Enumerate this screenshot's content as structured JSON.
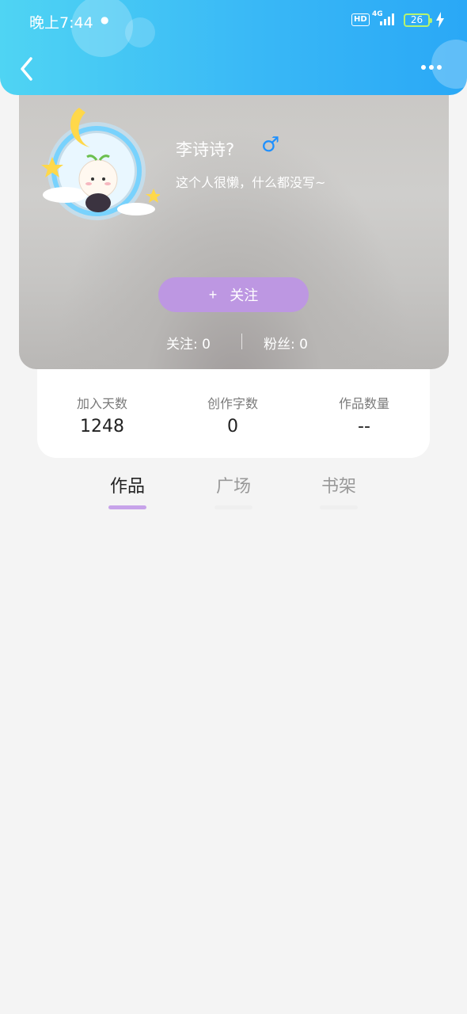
{
  "status_bar": {
    "time": "晚上7:44",
    "hd": "HD",
    "network": "4G",
    "battery": "26"
  },
  "profile": {
    "username": "李诗诗?",
    "gender_symbol": "♂",
    "bio": "这个人很懒，什么都没写~",
    "follow_button_icon": "+",
    "follow_button_label": "关注",
    "following_label": "关注: 0",
    "followers_label": "粉丝: 0"
  },
  "stats": [
    {
      "label": "加入天数",
      "value": "1248"
    },
    {
      "label": "创作字数",
      "value": "0"
    },
    {
      "label": "作品数量",
      "value": "--"
    }
  ],
  "tabs": [
    {
      "label": "作品",
      "active": true
    },
    {
      "label": "广场",
      "active": false
    },
    {
      "label": "书架",
      "active": false
    }
  ],
  "colors": {
    "header_start": "#4fd4f3",
    "header_end": "#2aa8f6",
    "accent_purple": "#bd97e2",
    "tab_indicator": "#c7a3ea",
    "gender_blue": "#1e90ff"
  },
  "icons": [
    "back-arrow-icon",
    "more-dots-icon",
    "male-icon",
    "plus-icon",
    "signal-icon",
    "battery-icon",
    "charging-icon"
  ]
}
